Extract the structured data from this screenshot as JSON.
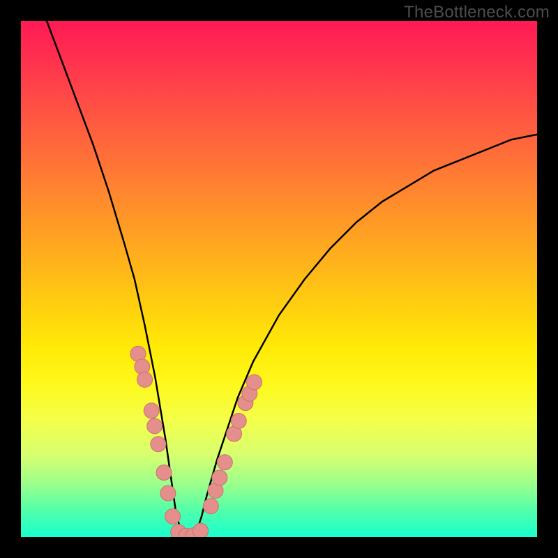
{
  "watermark": "TheBottleneck.com",
  "colors": {
    "background": "#000000",
    "curve": "#000000",
    "marker_fill": "#e48f8c",
    "marker_stroke": "#c9726e"
  },
  "chart_data": {
    "type": "line",
    "title": "",
    "xlabel": "",
    "ylabel": "",
    "xlim": [
      0,
      100
    ],
    "ylim": [
      0,
      100
    ],
    "grid": false,
    "legend": false,
    "series": [
      {
        "name": "bottleneck-curve",
        "x": [
          5,
          8,
          11,
          14,
          17,
          20,
          22,
          24,
          26,
          27,
          28,
          29,
          30,
          31,
          32,
          33,
          34,
          35,
          36,
          38,
          40,
          42,
          45,
          50,
          55,
          60,
          65,
          70,
          75,
          80,
          85,
          90,
          95,
          100
        ],
        "y": [
          100,
          92,
          84,
          76,
          67,
          57,
          50,
          41,
          31,
          25,
          19,
          12,
          5,
          1,
          0,
          0,
          1,
          4,
          8,
          15,
          21,
          27,
          34,
          43,
          50,
          56,
          61,
          65,
          68,
          71,
          73,
          75,
          77,
          78
        ]
      }
    ],
    "markers": [
      {
        "x": 22.7,
        "y": 35.5
      },
      {
        "x": 23.5,
        "y": 33
      },
      {
        "x": 24,
        "y": 30.5
      },
      {
        "x": 25.3,
        "y": 24.5
      },
      {
        "x": 25.9,
        "y": 21.5
      },
      {
        "x": 26.6,
        "y": 18
      },
      {
        "x": 27.7,
        "y": 12.5
      },
      {
        "x": 28.5,
        "y": 8.5
      },
      {
        "x": 29.4,
        "y": 4
      },
      {
        "x": 30.5,
        "y": 1
      },
      {
        "x": 32,
        "y": 0.2
      },
      {
        "x": 33.4,
        "y": 0.3
      },
      {
        "x": 34.8,
        "y": 1.2
      },
      {
        "x": 36.8,
        "y": 6
      },
      {
        "x": 37.7,
        "y": 9
      },
      {
        "x": 38.5,
        "y": 11.5
      },
      {
        "x": 39.5,
        "y": 14.5
      },
      {
        "x": 41.3,
        "y": 20
      },
      {
        "x": 42.2,
        "y": 22.5
      },
      {
        "x": 43.5,
        "y": 26
      },
      {
        "x": 44.3,
        "y": 27.8
      },
      {
        "x": 45.2,
        "y": 30
      }
    ]
  }
}
